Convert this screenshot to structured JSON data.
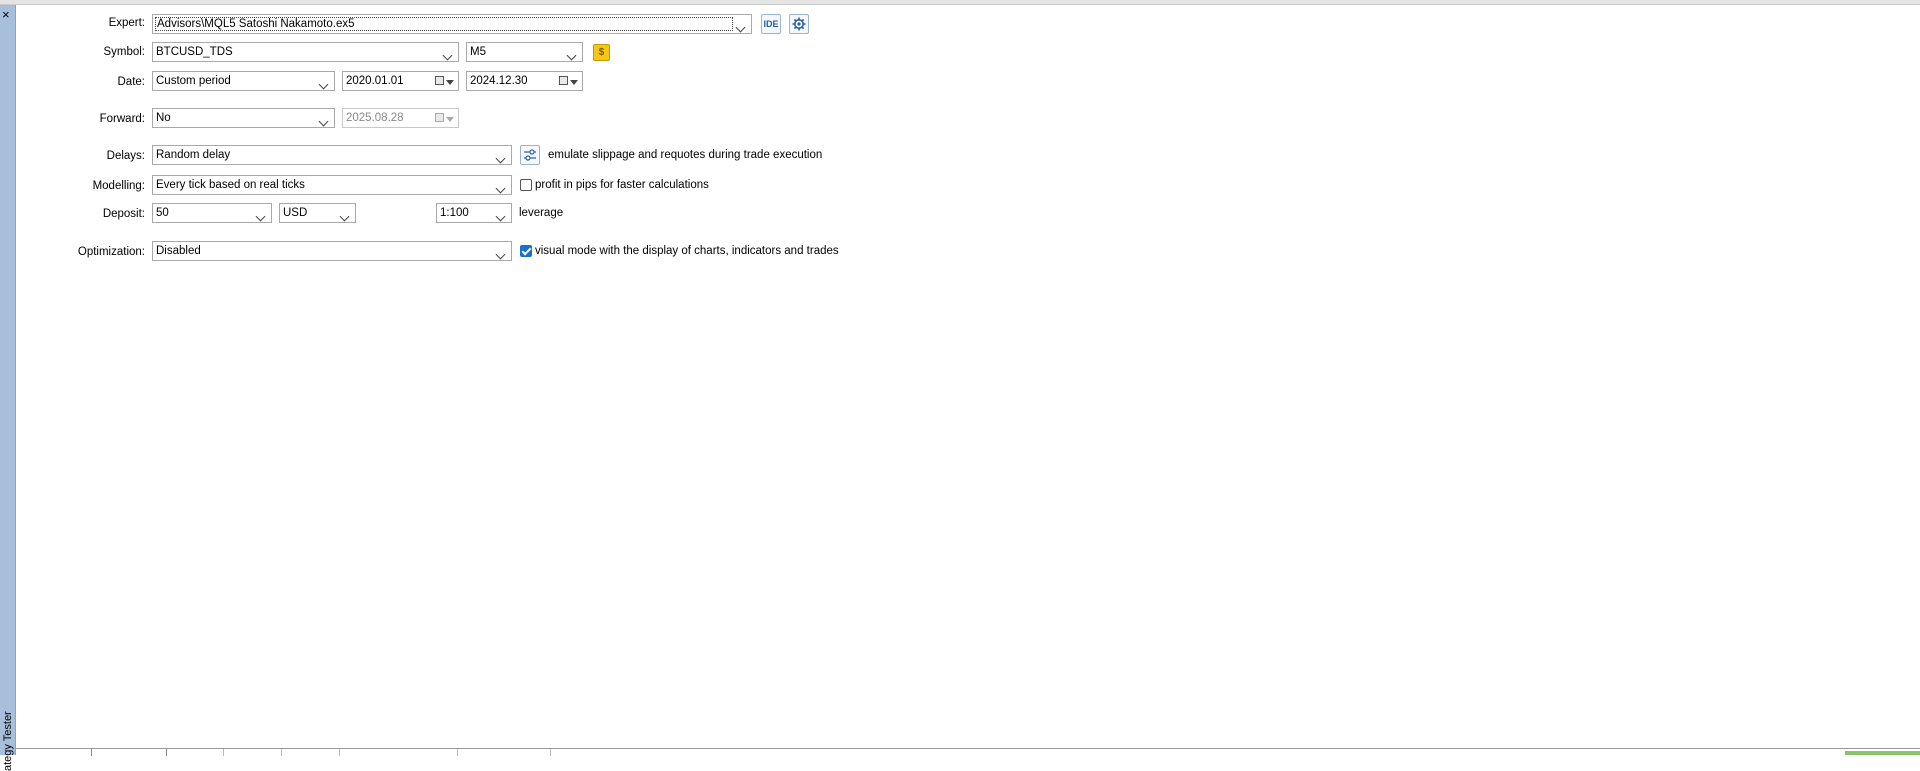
{
  "sidebar": {
    "close_glyph": "×",
    "title": "ategy Tester"
  },
  "expert": {
    "label": "Expert:",
    "value": "Advisors\\MQL5 Satoshi Nakamoto.ex5",
    "ide_label": "IDE",
    "settings_icon": "gear-icon"
  },
  "symbol": {
    "label": "Symbol:",
    "value": "BTCUSD_TDS",
    "timeframe": "M5",
    "symbol_button_glyph": "$"
  },
  "date": {
    "label": "Date:",
    "period": "Custom period",
    "from": "2020.01.01",
    "to": "2024.12.30"
  },
  "forward": {
    "label": "Forward:",
    "value": "No",
    "date": "2025.08.28"
  },
  "delays": {
    "label": "Delays:",
    "value": "Random delay",
    "note": "emulate slippage and requotes during trade execution"
  },
  "modelling": {
    "label": "Modelling:",
    "value": "Every tick based on real ticks",
    "checkbox_label": "profit in pips for faster calculations",
    "checked": false
  },
  "deposit": {
    "label": "Deposit:",
    "amount": "50",
    "currency": "USD",
    "leverage": "1:100",
    "leverage_label": "leverage"
  },
  "optimization": {
    "label": "Optimization:",
    "value": "Disabled",
    "checkbox_label": "visual mode with the display of charts, indicators and trades",
    "checked": true
  },
  "colors": {
    "sidebar": "#a7bfdb",
    "checkbox_on": "#1a6fd0",
    "coin": "#f5c518",
    "status_green": "#8ac46a"
  }
}
